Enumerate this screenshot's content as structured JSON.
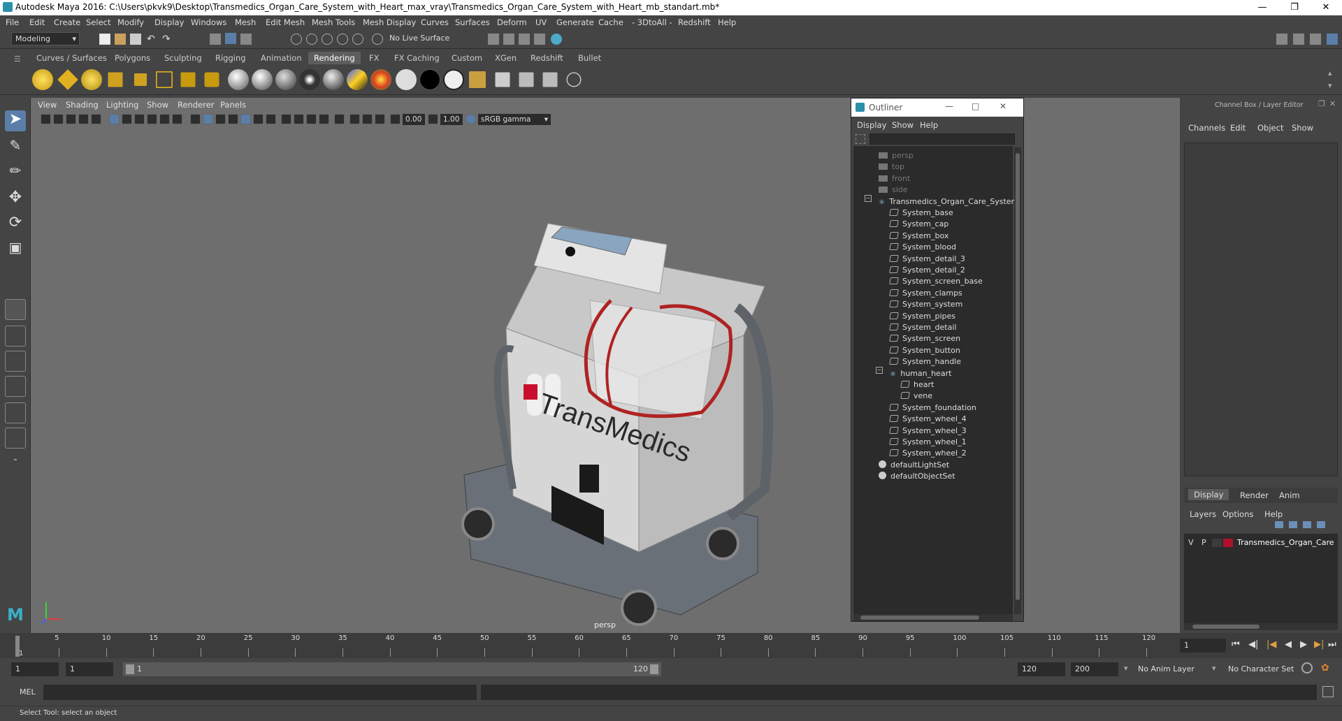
{
  "window": {
    "title": "Autodesk Maya 2016: C:\\Users\\pkvk9\\Desktop\\Transmedics_Organ_Care_System_with_Heart_max_vray\\Transmedics_Organ_Care_System_with_Heart_mb_standart.mb*"
  },
  "menubar": [
    "File",
    "Edit",
    "Create",
    "Select",
    "Modify",
    "Display",
    "Windows",
    "Mesh",
    "Edit Mesh",
    "Mesh Tools",
    "Mesh Display",
    "Curves",
    "Surfaces",
    "Deform",
    "UV",
    "Generate",
    "Cache",
    "- 3DtoAll -",
    "Redshift",
    "Help"
  ],
  "status": {
    "mode": "Modeling",
    "live_surface": "No Live Surface"
  },
  "shelf_tabs": [
    "Curves / Surfaces",
    "Polygons",
    "Sculpting",
    "Rigging",
    "Animation",
    "Rendering",
    "FX",
    "FX Caching",
    "Custom",
    "XGen",
    "Redshift",
    "Bullet"
  ],
  "shelf_active": "Rendering",
  "viewport": {
    "menu": [
      "View",
      "Shading",
      "Lighting",
      "Show",
      "Renderer",
      "Panels"
    ],
    "field_a": "0.00",
    "field_b": "1.00",
    "color_space": "sRGB gamma",
    "camera": "persp",
    "model_brand": "TransMedics"
  },
  "outliner": {
    "title": "Outliner",
    "menu": [
      "Display",
      "Show",
      "Help"
    ],
    "cameras": [
      "persp",
      "top",
      "front",
      "side"
    ],
    "root": "Transmedics_Organ_Care_System",
    "children_a": [
      "System_base",
      "System_cap",
      "System_box",
      "System_blood",
      "System_detail_3",
      "System_detail_2",
      "System_screen_base",
      "System_clamps",
      "System_system",
      "System_pipes",
      "System_detail",
      "System_screen",
      "System_button",
      "System_handle"
    ],
    "group": "human_heart",
    "group_children": [
      "heart",
      "vene"
    ],
    "children_b": [
      "System_foundation",
      "System_wheel_4",
      "System_wheel_3",
      "System_wheel_1",
      "System_wheel_2"
    ],
    "sets": [
      "defaultLightSet",
      "defaultObjectSet"
    ]
  },
  "channel_box": {
    "title": "Channel Box / Layer Editor",
    "menu": [
      "Channels",
      "Edit",
      "Object",
      "Show"
    ],
    "layer_tabs": [
      "Display",
      "Render",
      "Anim"
    ],
    "layer_active": "Display",
    "layer_menu": [
      "Layers",
      "Options",
      "Help"
    ],
    "layer": {
      "v": "V",
      "p": "P",
      "name": "Transmedics_Organ_Care",
      "color": "#b0102a"
    }
  },
  "timeline": {
    "ticks": [
      "5",
      "10",
      "15",
      "20",
      "25",
      "30",
      "35",
      "40",
      "45",
      "50",
      "55",
      "60",
      "65",
      "70",
      "75",
      "80",
      "85",
      "90",
      "95",
      "100",
      "105",
      "110",
      "115",
      "120"
    ],
    "current": "1",
    "current_field": "1"
  },
  "range": {
    "start": "1",
    "start2": "1",
    "slider_start": "1",
    "slider_end": "120",
    "end": "120",
    "end2": "200",
    "anim_layer": "No Anim Layer",
    "char_set": "No Character Set"
  },
  "command": {
    "lang": "MEL"
  },
  "help": {
    "text": "Select Tool: select an object"
  }
}
